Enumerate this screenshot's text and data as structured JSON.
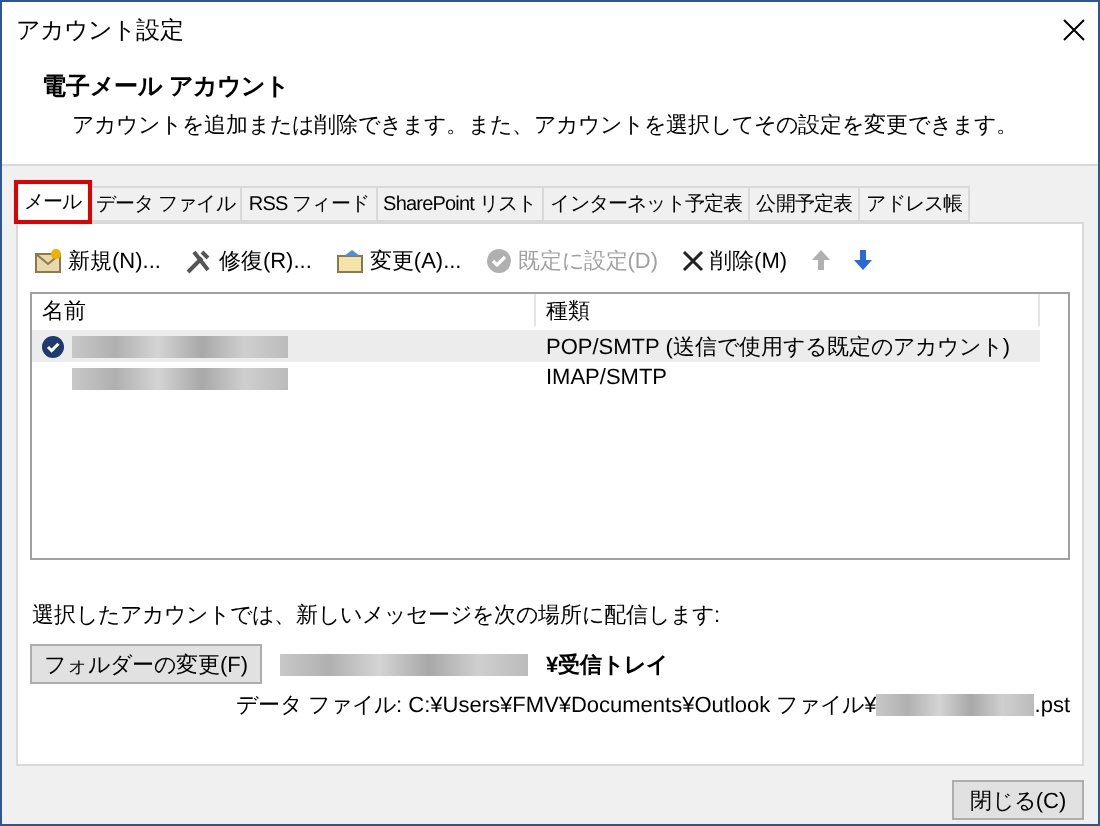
{
  "window": {
    "title": "アカウント設定"
  },
  "header": {
    "title": "電子メール アカウント",
    "description": "アカウントを追加または削除できます。また、アカウントを選択してその設定を変更できます。"
  },
  "tabs": [
    {
      "label": "メール",
      "selected": true,
      "highlighted": true
    },
    {
      "label": "データ ファイル",
      "selected": false,
      "highlighted": false
    },
    {
      "label": "RSS フィード",
      "selected": false,
      "highlighted": false
    },
    {
      "label": "SharePoint リスト",
      "selected": false,
      "highlighted": false
    },
    {
      "label": "インターネット予定表",
      "selected": false,
      "highlighted": false
    },
    {
      "label": "公開予定表",
      "selected": false,
      "highlighted": false
    },
    {
      "label": "アドレス帳",
      "selected": false,
      "highlighted": false
    }
  ],
  "toolbar": [
    {
      "kind": "new",
      "label": "新規(N)...",
      "disabled": false
    },
    {
      "kind": "repair",
      "label": "修復(R)...",
      "disabled": false
    },
    {
      "kind": "change",
      "label": "変更(A)...",
      "disabled": false
    },
    {
      "kind": "default",
      "label": "既定に設定(D)",
      "disabled": true
    },
    {
      "kind": "delete",
      "label": "削除(M)",
      "disabled": false
    },
    {
      "kind": "up",
      "disabled": true
    },
    {
      "kind": "down",
      "disabled": false
    }
  ],
  "table": {
    "columns": [
      "名前",
      "種類"
    ],
    "rows": [
      {
        "type": "POP/SMTP (送信で使用する既定のアカウント)",
        "default": true,
        "selected": true
      },
      {
        "type": "IMAP/SMTP",
        "default": false,
        "selected": false
      }
    ]
  },
  "delivery": {
    "label": "選択したアカウントでは、新しいメッセージを次の場所に配信します:",
    "button": "フォルダーの変更(F)",
    "folder": "¥受信トレイ",
    "data_file_prefix": "データ ファイル: C:¥Users¥FMV¥Documents¥Outlook ファイル¥",
    "data_file_suffix": ".pst"
  },
  "buttons": [
    "閉じる(C)"
  ]
}
